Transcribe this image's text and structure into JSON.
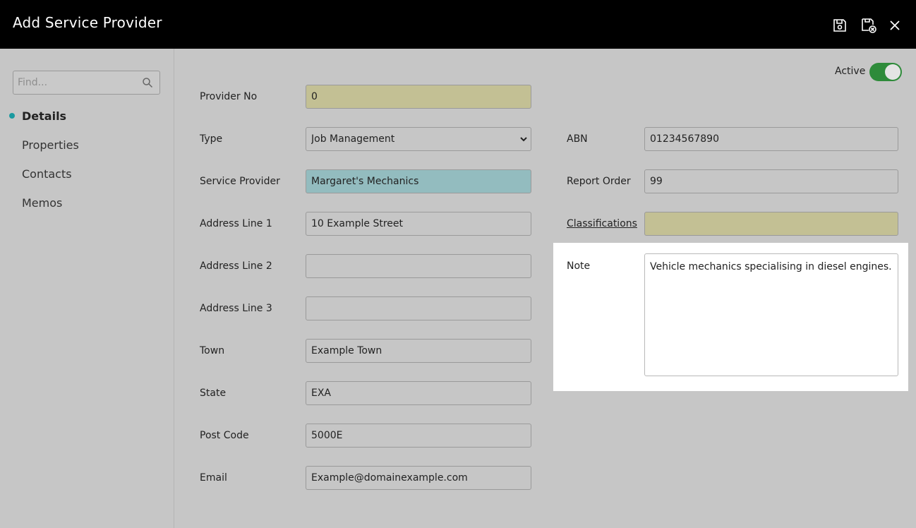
{
  "window": {
    "title": "Add Service Provider"
  },
  "toolbar": {
    "save_icon": "save-icon",
    "save_close_icon": "save-close-icon",
    "close_icon": "close-icon"
  },
  "sidebar": {
    "search_placeholder": "Find...",
    "items": [
      {
        "label": "Details",
        "active": true
      },
      {
        "label": "Properties",
        "active": false
      },
      {
        "label": "Contacts",
        "active": false
      },
      {
        "label": "Memos",
        "active": false
      }
    ]
  },
  "status": {
    "label": "Active",
    "on": true
  },
  "form": {
    "provider_no": {
      "label": "Provider No",
      "value": "0"
    },
    "type": {
      "label": "Type",
      "value": "Job Management"
    },
    "service_provider": {
      "label": "Service Provider",
      "value": "Margaret's Mechanics"
    },
    "address1": {
      "label": "Address Line 1",
      "value": "10 Example Street"
    },
    "address2": {
      "label": "Address Line 2",
      "value": ""
    },
    "address3": {
      "label": "Address Line 3",
      "value": ""
    },
    "town": {
      "label": "Town",
      "value": "Example Town"
    },
    "state": {
      "label": "State",
      "value": "EXA"
    },
    "postcode": {
      "label": "Post Code",
      "value": "5000E"
    },
    "email": {
      "label": "Email",
      "value": "Example@domainexample.com"
    },
    "abn": {
      "label": "ABN",
      "value": "01234567890"
    },
    "report_order": {
      "label": "Report Order",
      "value": "99"
    },
    "classifications": {
      "label": "Classifications",
      "value": ""
    },
    "note": {
      "label": "Note",
      "value": "Vehicle mechanics specialising in diesel engines."
    }
  },
  "colors": {
    "titlebar": "#000000",
    "background": "#c6c6c6",
    "required_field": "#c3c094",
    "highlight_field": "#93bcbf",
    "toggle_on": "#2e8b3a",
    "nav_dot": "#1a9aa0"
  }
}
